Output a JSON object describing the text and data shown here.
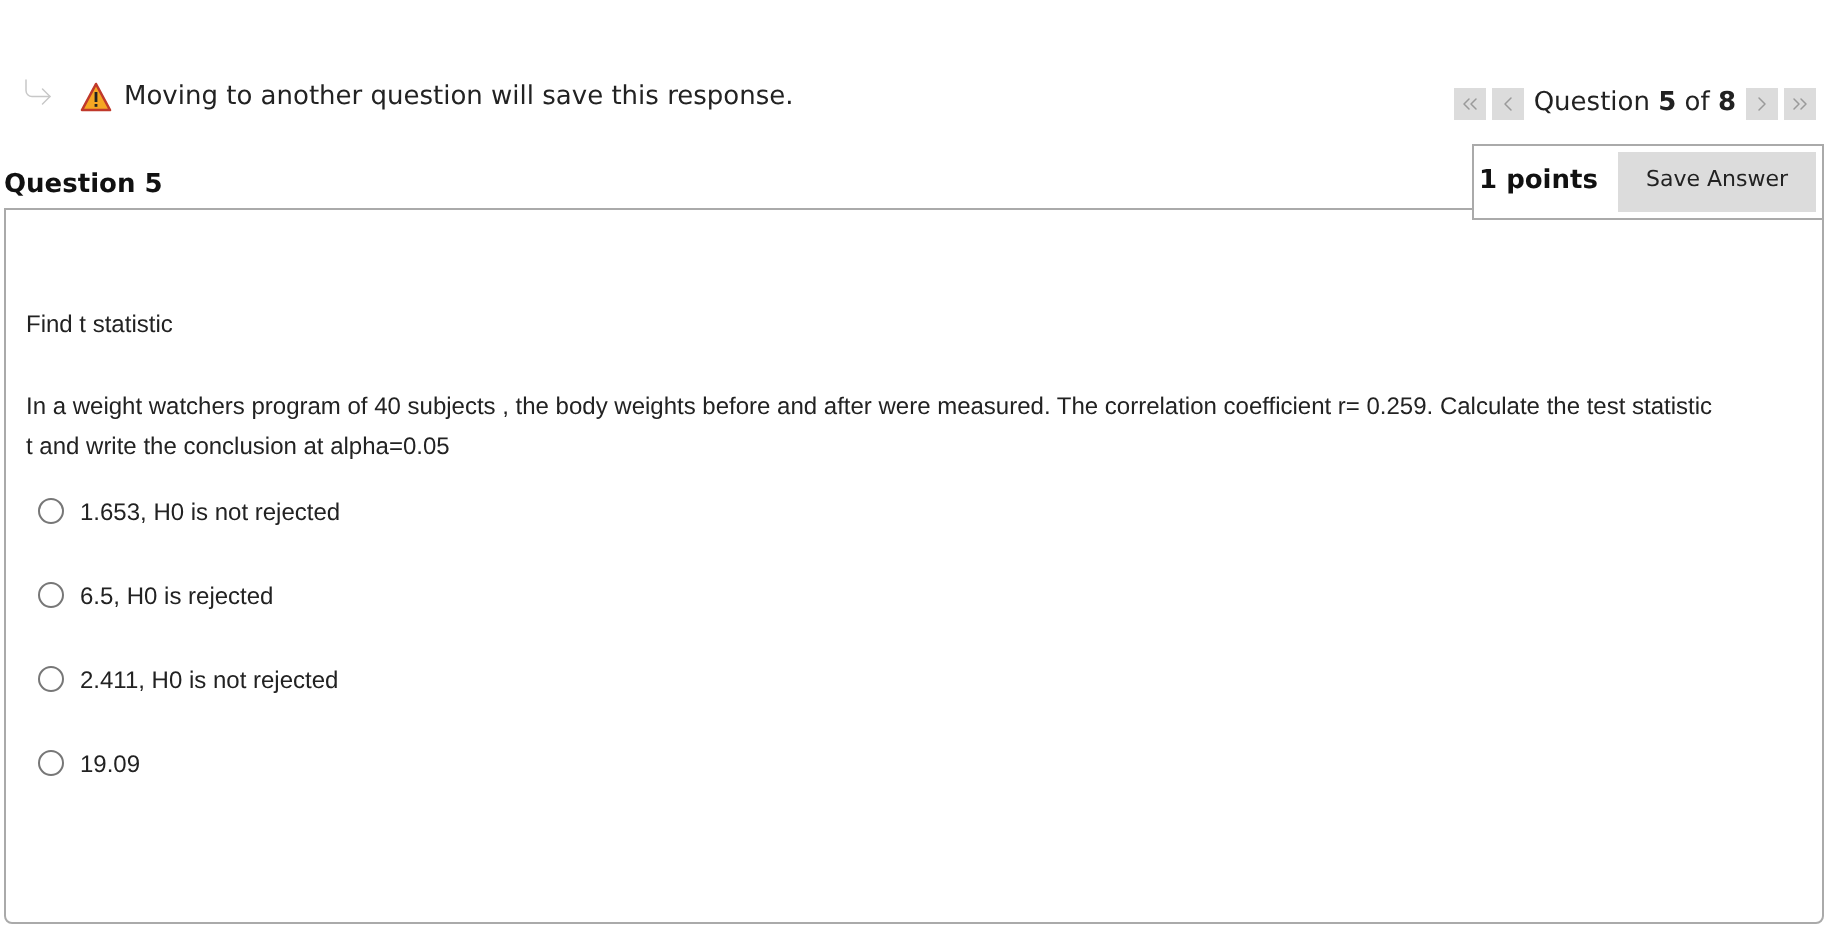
{
  "notice": {
    "text": "Moving to another question will save this response."
  },
  "navigation": {
    "label": "Question **5** of **8**"
  },
  "question": {
    "title": "Question 5",
    "points": "1 points",
    "save_button": "Save Answer",
    "prompt": "Find t statistic",
    "body": "In a weight watchers program of 40 subjects , the body weights before and after were measured. The correlation coefficient r= 0.259. Calculate the test statistic t and write the conclusion at alpha=0.05",
    "options": [
      {
        "label": "1.653, H0 is not rejected",
        "selected": false
      },
      {
        "label": "6.5, H0 is rejected",
        "selected": false
      },
      {
        "label": "2.411, H0 is not rejected",
        "selected": false
      },
      {
        "label": "19.09",
        "selected": false
      }
    ]
  }
}
